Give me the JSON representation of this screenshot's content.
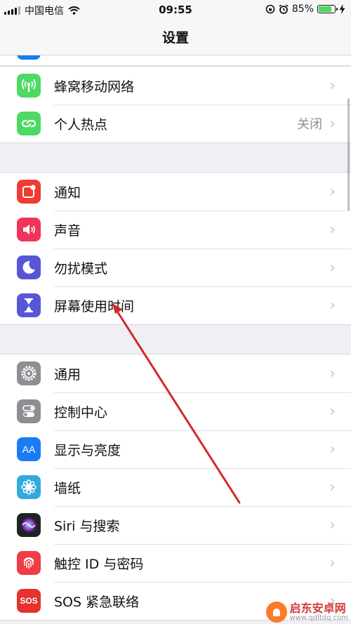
{
  "status_bar": {
    "carrier": "中国电信",
    "time": "09:55",
    "battery_percent": "85%",
    "battery_level": 0.85,
    "icons": [
      "signal-icon",
      "wifi-icon",
      "rotation-lock-icon",
      "alarm-icon",
      "battery-icon",
      "charging-icon"
    ]
  },
  "nav": {
    "title": "设置"
  },
  "groups": [
    {
      "items": [
        {
          "label": "蜂窝移动网络",
          "icon": "cellular-icon",
          "color": "#4cd964"
        },
        {
          "label": "个人热点",
          "value": "关闭",
          "icon": "hotspot-icon",
          "color": "#4cd964"
        }
      ]
    },
    {
      "items": [
        {
          "label": "通知",
          "icon": "notifications-icon",
          "color": "#f03c33"
        },
        {
          "label": "声音",
          "icon": "sounds-icon",
          "color": "#f0345a"
        },
        {
          "label": "勿扰模式",
          "icon": "moon-icon",
          "color": "#5856d6"
        },
        {
          "label": "屏幕使用时间",
          "icon": "hourglass-icon",
          "color": "#5856d6"
        }
      ]
    },
    {
      "items": [
        {
          "label": "通用",
          "icon": "gear-icon",
          "color": "#8e8e93"
        },
        {
          "label": "控制中心",
          "icon": "switches-icon",
          "color": "#8e8e93"
        },
        {
          "label": "显示与亮度",
          "icon": "text-size-icon",
          "color": "#1a7cf5",
          "icon_text": "AA"
        },
        {
          "label": "墙纸",
          "icon": "flower-icon",
          "color": "#34aadc"
        },
        {
          "label": "Siri 与搜索",
          "icon": "siri-icon",
          "color": "#222222"
        },
        {
          "label": "触控 ID 与密码",
          "icon": "fingerprint-icon",
          "color": "#f03c46"
        },
        {
          "label": "SOS 紧急联络",
          "icon": "sos-icon",
          "color": "#e5322d",
          "icon_text": "SOS"
        }
      ]
    }
  ],
  "annotation": {
    "type": "red-arrow",
    "color": "#d22a2a",
    "points_to": "屏幕使用时间"
  },
  "watermark": {
    "title": "启东安卓网",
    "url": "www.qdltdq.com"
  }
}
